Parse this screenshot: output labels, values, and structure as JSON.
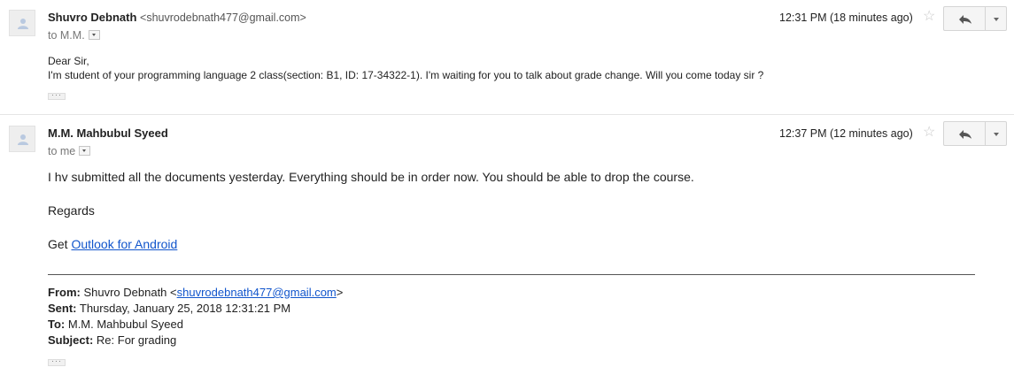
{
  "messages": [
    {
      "sender_name": "Shuvro Debnath",
      "sender_email": "<shuvrodebnath477@gmail.com>",
      "to_line": "to M.M.",
      "time": "12:31 PM (18 minutes ago)",
      "greeting": "Dear Sir,",
      "body": "I'm student of your programming language 2 class(section: B1, ID: 17-34322-1). I'm waiting for you to talk about grade change. Will you come today sir ?"
    },
    {
      "sender_name": "M.M. Mahbubul Syeed",
      "to_line": "to me",
      "time": "12:37 PM (12 minutes ago)",
      "paragraph1": "I hv submitted all the documents yesterday. Everything should be in order now. You should be able to drop the course.",
      "regards": "Regards",
      "get_prefix": "Get ",
      "outlook_link": "Outlook for Android",
      "quoted": {
        "from_label": "From:",
        "from_name": " Shuvro Debnath <",
        "from_email": "shuvrodebnath477@gmail.com",
        "from_close": ">",
        "sent_label": "Sent:",
        "sent_value": " Thursday, January 25, 2018 12:31:21 PM",
        "to_label": "To:",
        "to_value": " M.M. Mahbubul Syeed",
        "subject_label": "Subject:",
        "subject_value": " Re: For grading"
      }
    }
  ],
  "icons": {
    "avatar": "person-icon",
    "star": "star-icon",
    "reply": "reply-icon",
    "more": "chevron-down-icon"
  }
}
